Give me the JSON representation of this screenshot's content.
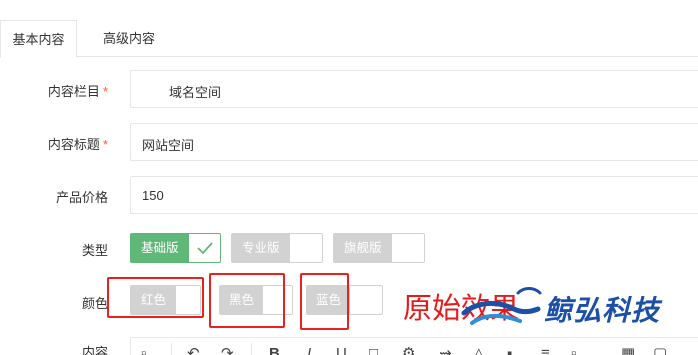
{
  "tabs": [
    {
      "label": "基本内容"
    },
    {
      "label": "高级内容"
    }
  ],
  "form": {
    "column": {
      "label": "内容栏目",
      "required": "*",
      "value": "域名空间"
    },
    "title": {
      "label": "内容标题",
      "required": "*",
      "value": "网站空间"
    },
    "price": {
      "label": "产品价格",
      "value": "150"
    },
    "type": {
      "label": "类型",
      "options": [
        "基础版",
        "专业版",
        "旗舰版"
      ],
      "selected": "基础版"
    },
    "color": {
      "label": "颜色",
      "options": [
        "红色",
        "黑色",
        "蓝色"
      ]
    },
    "content": {
      "label": "内容"
    }
  },
  "watermark": {
    "text": "原始效果",
    "brand": "鲸弘科技"
  },
  "colors": {
    "accent": "#5fb878",
    "unchecked": "#d2d2d2",
    "highlight": "#e8211d",
    "brand": "#1b4fa8"
  },
  "icons": [
    "check-icon",
    "undo-icon",
    "redo-icon",
    "bold-icon",
    "italic-icon",
    "underline-icon",
    "strikethrough-icon",
    "font-color-icon",
    "link-icon",
    "unlink-icon",
    "image-icon",
    "align-icon",
    "code-icon",
    "help-icon"
  ]
}
